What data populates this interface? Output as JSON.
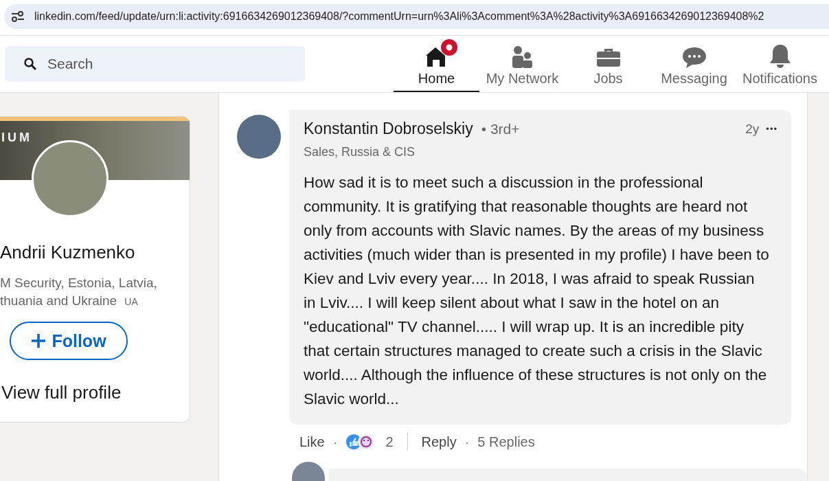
{
  "address_bar": {
    "url": "linkedin.com/feed/update/urn:li:activity:6916634269012369408/?commentUrn=urn%3Ali%3Acomment%3A%28activity%3A6916634269012369408%2"
  },
  "search": {
    "placeholder": "Search"
  },
  "nav": [
    {
      "kind": "home",
      "label": "Home",
      "selected": true,
      "badge": true
    },
    {
      "kind": "network",
      "label": "My Network",
      "selected": false,
      "badge": false
    },
    {
      "kind": "jobs",
      "label": "Jobs",
      "selected": false,
      "badge": false
    },
    {
      "kind": "messaging",
      "label": "Messaging",
      "selected": false,
      "badge": false
    },
    {
      "kind": "notifications",
      "label": "Notifications",
      "selected": false,
      "badge": false
    }
  ],
  "profile_card": {
    "banner_text": "IUM",
    "name": "Andrii Kuzmenko",
    "headline": "M Security, Estonia, Latvia, thuania and Ukraine",
    "flag_text": "UA",
    "follow_button": "Follow",
    "view_profile": "View full profile"
  },
  "comment": {
    "author": "Konstantin Dobroselskiy",
    "degree": "• 3rd+",
    "subtitle": "Sales, Russia & CIS",
    "time": "2y",
    "more": "•••",
    "text": "How sad it is to meet such a discussion in the professional community. It is gratifying that reasonable thoughts are heard not only from accounts with Slavic names. By the areas of my business activities (much wider than is presented in my profile) I have been to Kiev and Lviv every year.... In 2018, I was afraid to speak Russian in Lviv.... I will keep silent about what I saw in the hotel on an \"educational\" TV channel..... I will wrap up. It is an incredible pity that certain structures managed to create such a crisis in the Slavic world.... Although the influence of these structures is not only on the Slavic world...",
    "like": "Like",
    "separator_1": "·",
    "reaction_count": "2",
    "reply": "Reply",
    "separator_2": "·",
    "replies": "5 Replies"
  }
}
